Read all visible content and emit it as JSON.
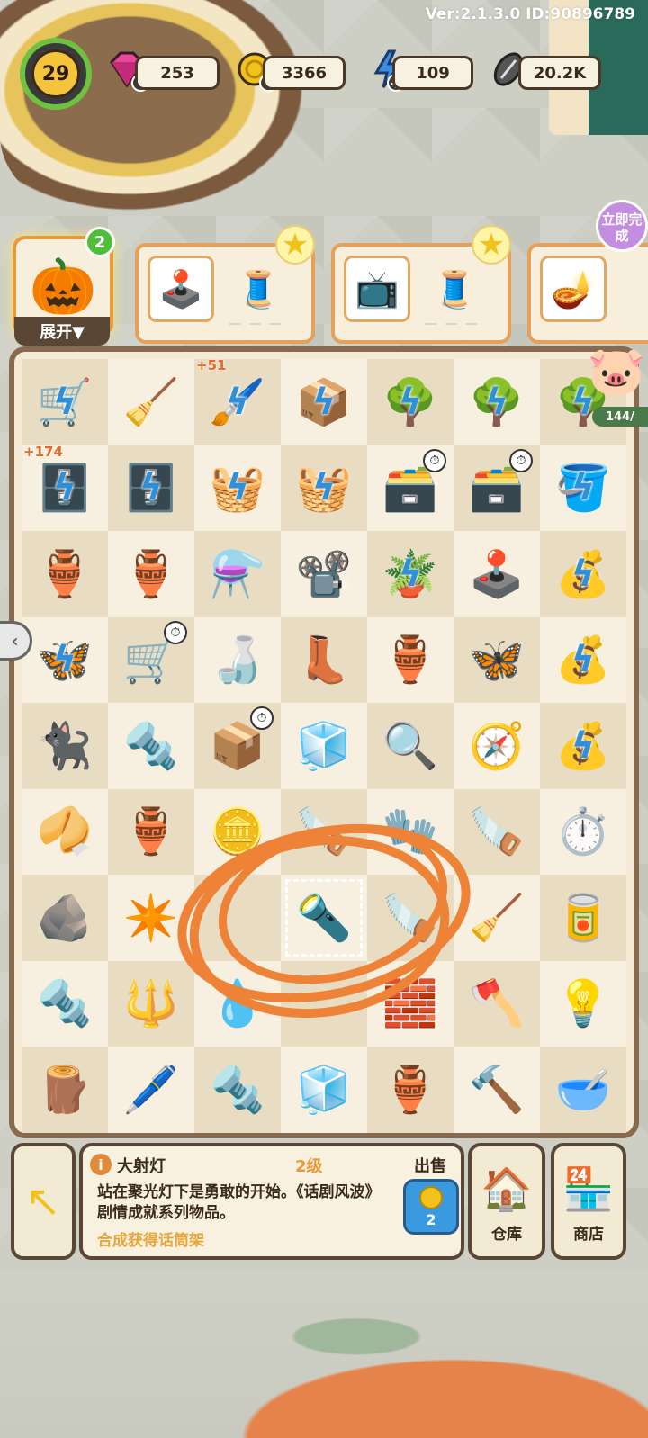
{
  "version": "Ver:2.1.3.0 ID:90896789",
  "level": "29",
  "resources": [
    {
      "name": "gems",
      "icon": "gem-icon",
      "value": "253"
    },
    {
      "name": "coins",
      "icon": "coin-icon",
      "value": "3366"
    },
    {
      "name": "energy",
      "icon": "lightning-icon",
      "value": "109"
    },
    {
      "name": "seeds",
      "icon": "seed-icon",
      "value": "20.2K"
    }
  ],
  "orders": {
    "expand_label": "展开▼",
    "expand_count": "2",
    "instant_complete": "立即完成",
    "piggy_progress": "144/"
  },
  "board": {
    "rows": [
      [
        {
          "icon": "🛒",
          "bolt": true
        },
        {
          "icon": "🧹"
        },
        {
          "icon": "🖌️",
          "bolt": true,
          "badge": "+51"
        },
        {
          "icon": "📦",
          "bolt": true
        },
        {
          "icon": "🌳",
          "bolt": true
        },
        {
          "icon": "🌳",
          "bolt": true
        },
        {
          "icon": "🌳",
          "bolt": true
        }
      ],
      [
        {
          "icon": "🗄️",
          "bolt": true,
          "badge": "+174"
        },
        {
          "icon": "🗄️",
          "bolt": true
        },
        {
          "icon": "🧺",
          "bolt": true
        },
        {
          "icon": "🧺",
          "bolt": true
        },
        {
          "icon": "🗃️",
          "timer": true
        },
        {
          "icon": "🗃️",
          "timer": true
        },
        {
          "icon": "🪣",
          "bolt": true
        }
      ],
      [
        {
          "icon": "🏺"
        },
        {
          "icon": "🏺"
        },
        {
          "icon": "⚗️"
        },
        {
          "icon": "📽️"
        },
        {
          "icon": "🪴",
          "bolt": true
        },
        {
          "icon": "🕹️"
        },
        {
          "icon": "💰",
          "bolt": true
        }
      ],
      [
        {
          "icon": "🦋",
          "bolt": true
        },
        {
          "icon": "🛒",
          "timer": true
        },
        {
          "icon": "🍶"
        },
        {
          "icon": "👢"
        },
        {
          "icon": "🏺"
        },
        {
          "icon": "🦋"
        },
        {
          "icon": "💰",
          "bolt": true
        }
      ],
      [
        {
          "icon": "🐈‍⬛"
        },
        {
          "icon": "🔩"
        },
        {
          "icon": "📦",
          "timer": true
        },
        {
          "icon": "🧊"
        },
        {
          "icon": "🔍"
        },
        {
          "icon": "🧭"
        },
        {
          "icon": "💰",
          "bolt": true
        }
      ],
      [
        {
          "icon": "🥠"
        },
        {
          "icon": "🏺"
        },
        {
          "icon": "🪙"
        },
        {
          "icon": "🪚"
        },
        {
          "icon": "🧤"
        },
        {
          "icon": "🪚"
        },
        {
          "icon": "⏱️"
        }
      ],
      [
        {
          "icon": "🪨"
        },
        {
          "icon": "✴️"
        },
        {
          "icon": ""
        },
        {
          "icon": "🔦",
          "selected": true
        },
        {
          "icon": "🪚"
        },
        {
          "icon": "🧹"
        },
        {
          "icon": "🥫"
        }
      ],
      [
        {
          "icon": "🔩"
        },
        {
          "icon": "🔱"
        },
        {
          "icon": "💧"
        },
        {
          "icon": ""
        },
        {
          "icon": "🧱"
        },
        {
          "icon": "🪓"
        },
        {
          "icon": "💡"
        }
      ],
      [
        {
          "icon": "🪵"
        },
        {
          "icon": "🖊️"
        },
        {
          "icon": "🔩"
        },
        {
          "icon": "🧊"
        },
        {
          "icon": "🏺"
        },
        {
          "icon": "🔨"
        },
        {
          "icon": "🥣"
        }
      ]
    ]
  },
  "info": {
    "name": "大射灯",
    "level": "2级",
    "description": "站在聚光灯下是勇敢的开始。《话剧风波》剧情成就系列物品。",
    "merge_hint": "合成获得话筒架",
    "sell_label": "出售",
    "sell_price": "2"
  },
  "buttons": {
    "warehouse": "仓库",
    "shop": "商店"
  },
  "colors": {
    "accent_orange": "#e6873a",
    "energy_blue": "#2f8fd8",
    "frame_brown": "#5a4634"
  }
}
